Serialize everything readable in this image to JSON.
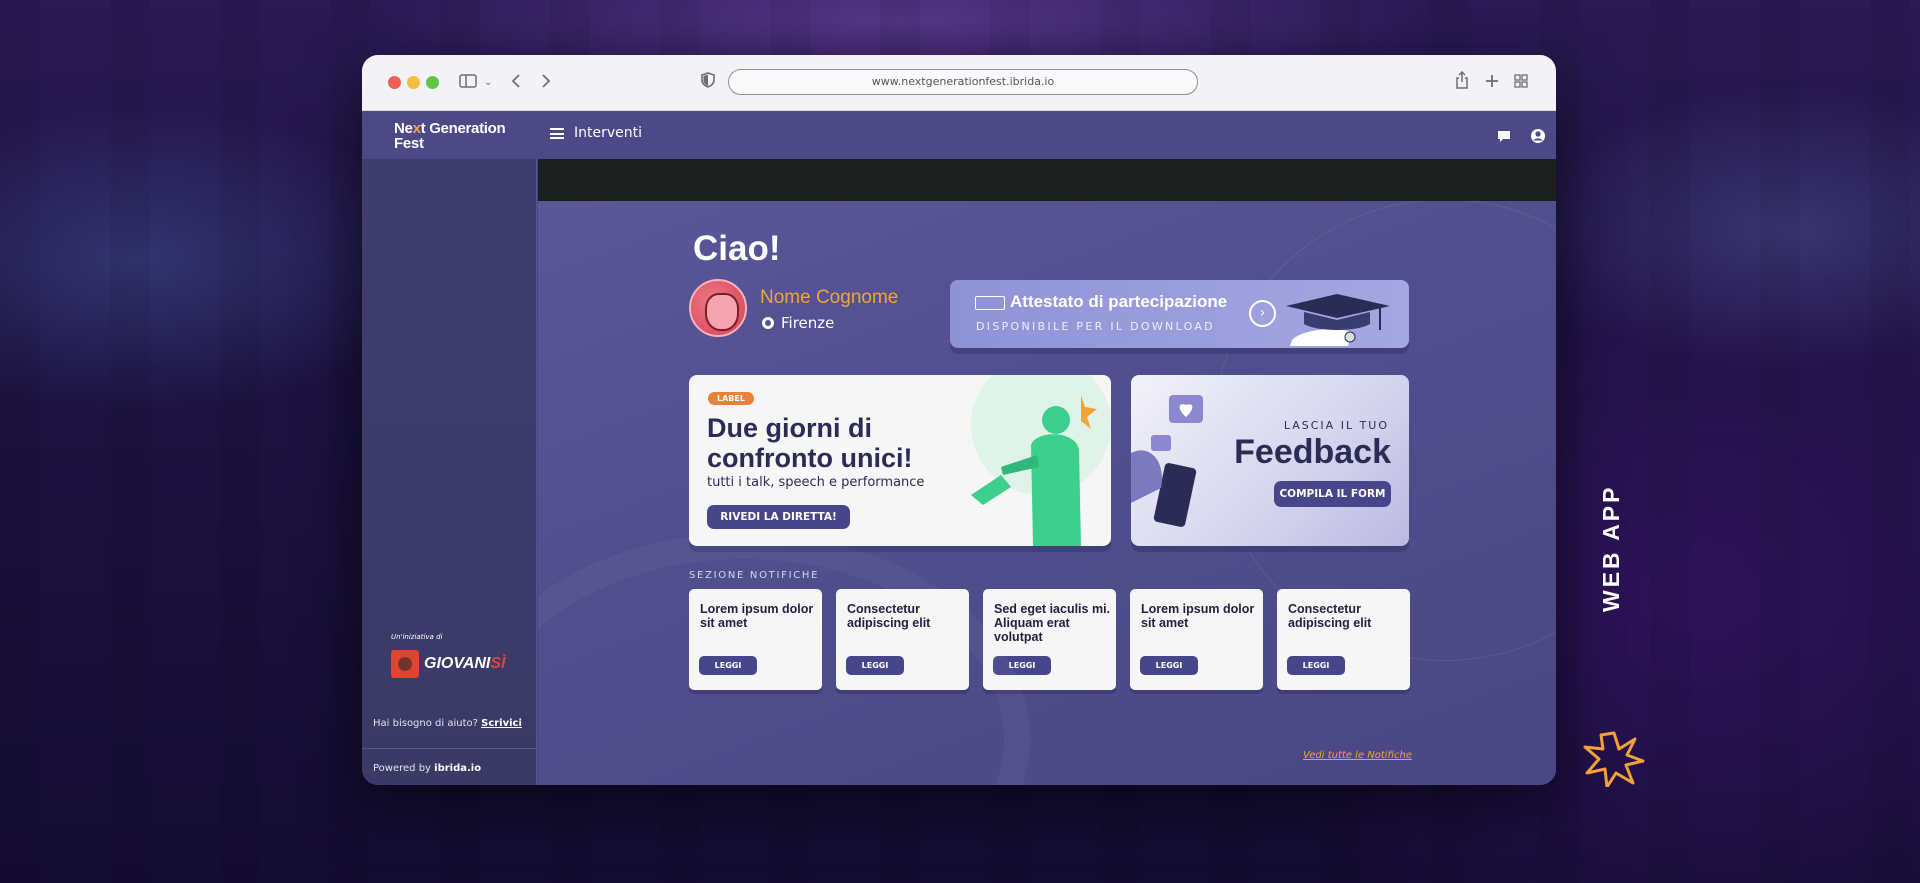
{
  "browser": {
    "url": "www.nextgenerationfest.ibrida.io",
    "icons": [
      "sidebar-toggle-icon",
      "chevron-down-icon",
      "back-icon",
      "forward-icon",
      "shield-icon",
      "share-icon",
      "new-tab-icon",
      "tabs-grid-icon"
    ]
  },
  "header": {
    "logo_line1_a": "Ne",
    "logo_line1_x": "x",
    "logo_line1_b": "t Generation",
    "logo_line2": "Fest",
    "menu_label": "Interventi",
    "icons": [
      "chat-icon",
      "user-icon"
    ]
  },
  "sidebar": {
    "initiative_label": "Un'iniziativa di",
    "partner_name": "GIOVANI",
    "partner_suffix": "SÌ",
    "help_text": "Hai bisogno di aiuto?",
    "help_link": "Scrivici",
    "powered_text": "Powered by",
    "powered_brand": "ibrida.io"
  },
  "main": {
    "greeting": "Ciao!",
    "user": {
      "name": "Nome Cognome",
      "location": "Firenze"
    },
    "certificate": {
      "title": "Attestato di partecipazione",
      "subtitle": "DISPONIBILE PER IL DOWNLOAD"
    },
    "promo": {
      "label": "LABEL",
      "title": "Due giorni di confronto unici!",
      "subtitle": "tutti i talk, speech e performance",
      "button": "RIVEDI LA DIRETTA!"
    },
    "feedback": {
      "pretitle": "LASCIA IL TUO",
      "title": "Feedback",
      "button": "COMPILA IL FORM"
    },
    "notifications": {
      "section_label": "SEZIONE NOTIFICHE",
      "items": [
        {
          "title": "Lorem ipsum dolor sit amet",
          "button": "LEGGI"
        },
        {
          "title": "Consectetur adipiscing elit",
          "button": "LEGGI"
        },
        {
          "title": "Sed eget iaculis mi. Aliquam erat volutpat",
          "button": "LEGGI"
        },
        {
          "title": "Lorem ipsum dolor sit amet",
          "button": "LEGGI"
        },
        {
          "title": "Consectetur adipiscing elit",
          "button": "LEGGI"
        }
      ],
      "see_all": "Vedi tutte le Notifiche"
    }
  },
  "side_caption": "WEB APP",
  "colors": {
    "accent": "#f3a23a",
    "primary": "#4c4986",
    "dark_text": "#2b2c55"
  }
}
